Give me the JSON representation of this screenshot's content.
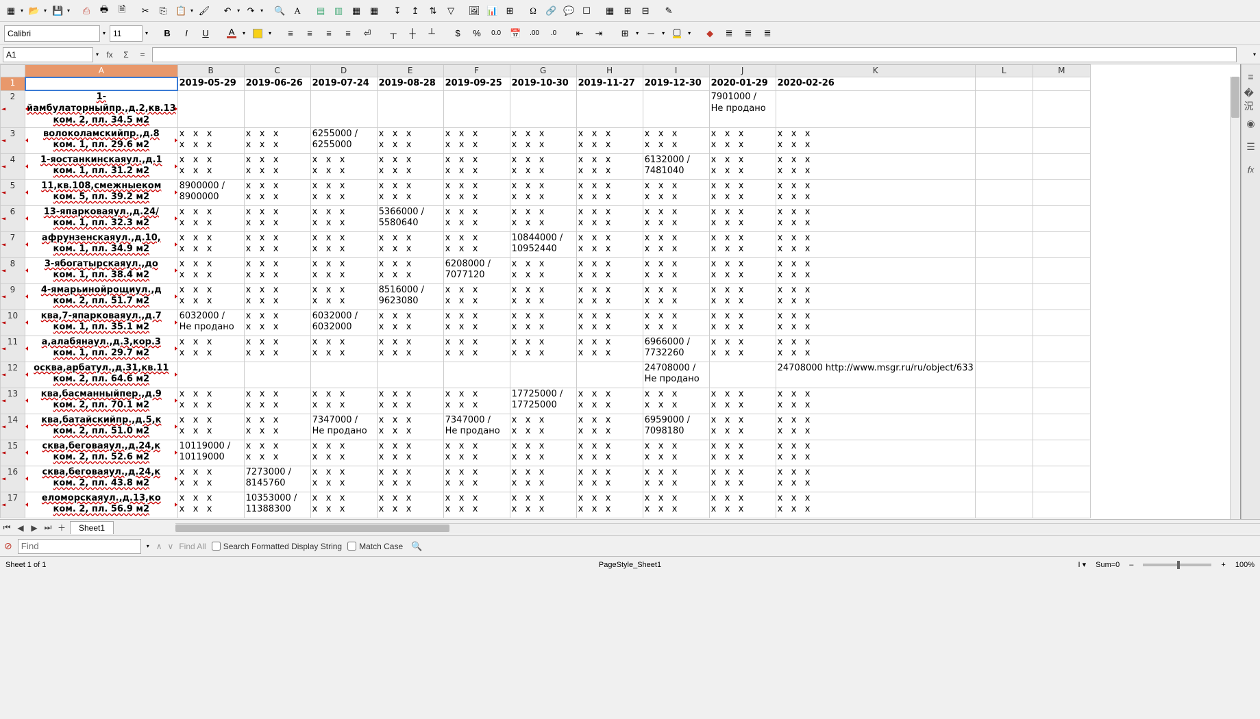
{
  "toolbar2": {
    "font_name": "Calibri",
    "font_size": "11"
  },
  "formula": {
    "cell_ref": "A1",
    "input": ""
  },
  "columns": [
    "A",
    "B",
    "C",
    "D",
    "E",
    "F",
    "G",
    "H",
    "I",
    "J",
    "K",
    "L",
    "M"
  ],
  "header_dates": [
    "2019-05-29",
    "2019-06-26",
    "2019-07-24",
    "2019-08-28",
    "2019-09-25",
    "2019-10-30",
    "2019-11-27",
    "2019-12-30",
    "2020-01-29",
    "2020-02-26"
  ],
  "rows": [
    {
      "n": 2,
      "a": "1-йамбулаторныйпр.,д.2,кв.13\nком. 2, пл. 34.5 м2",
      "b": "",
      "c": "",
      "d": "",
      "e": "",
      "f": "",
      "g": "",
      "h": "",
      "i": "",
      "j": "7901000 /\nНе продано",
      "k": ""
    },
    {
      "n": 3,
      "a": "волоколамскийпр.,д.8\nком. 1, пл. 29.6 м2",
      "b": "x   x   x\nx   x   x",
      "c": "x   x   x\nx   x   x",
      "d": "6255000 /\n6255000",
      "e": "x   x   x\nx   x   x",
      "f": "x   x   x\nx   x   x",
      "g": "x   x   x\nx   x   x",
      "h": "x   x   x\nx   x   x",
      "i": "x   x   x\nx   x   x",
      "j": "x   x   x\nx   x   x",
      "k": "x   x   x\nx   x   x"
    },
    {
      "n": 4,
      "a": "1-яостанкинскаяул.,д.1\nком. 1, пл. 31.2 м2",
      "b": "x   x   x\nx   x   x",
      "c": "x   x   x\nx   x   x",
      "d": "x   x   x\nx   x   x",
      "e": "x   x   x\nx   x   x",
      "f": "x   x   x\nx   x   x",
      "g": "x   x   x\nx   x   x",
      "h": "x   x   x\nx   x   x",
      "i": "6132000 /\n7481040",
      "j": "x   x   x\nx   x   x",
      "k": "x   x   x\nx   x   x"
    },
    {
      "n": 5,
      "a": "11,кв.108,смежныеком\nком. 5, пл. 39.2 м2",
      "b": "8900000 /\n8900000",
      "c": "x   x   x\nx   x   x",
      "d": "x   x   x\nx   x   x",
      "e": "x   x   x\nx   x   x",
      "f": "x   x   x\nx   x   x",
      "g": "x   x   x\nx   x   x",
      "h": "x   x   x\nx   x   x",
      "i": "x   x   x\nx   x   x",
      "j": "x   x   x\nx   x   x",
      "k": "x   x   x\nx   x   x"
    },
    {
      "n": 6,
      "a": "13-япарковаяул.,д.24/\nком. 1, пл. 32.3 м2",
      "b": "x   x   x\nx   x   x",
      "c": "x   x   x\nx   x   x",
      "d": "x   x   x\nx   x   x",
      "e": "5366000 /\n5580640",
      "f": "x   x   x\nx   x   x",
      "g": "x   x   x\nx   x   x",
      "h": "x   x   x\nx   x   x",
      "i": "x   x   x\nx   x   x",
      "j": "x   x   x\nx   x   x",
      "k": "x   x   x\nx   x   x"
    },
    {
      "n": 7,
      "a": "афрунзенскаяул.,д.10,\nком. 1, пл. 34.9 м2",
      "b": "x   x   x\nx   x   x",
      "c": "x   x   x\nx   x   x",
      "d": "x   x   x\nx   x   x",
      "e": "x   x   x\nx   x   x",
      "f": "x   x   x\nx   x   x",
      "g": "10844000 /\n10952440",
      "h": "x   x   x\nx   x   x",
      "i": "x   x   x\nx   x   x",
      "j": "x   x   x\nx   x   x",
      "k": "x   x   x\nx   x   x"
    },
    {
      "n": 8,
      "a": "3-ябогатырскаяул.,до\nком. 1, пл. 38.4 м2",
      "b": "x   x   x\nx   x   x",
      "c": "x   x   x\nx   x   x",
      "d": "x   x   x\nx   x   x",
      "e": "x   x   x\nx   x   x",
      "f": "6208000 /\n7077120",
      "g": "x   x   x\nx   x   x",
      "h": "x   x   x\nx   x   x",
      "i": "x   x   x\nx   x   x",
      "j": "x   x   x\nx   x   x",
      "k": "x   x   x\nx   x   x"
    },
    {
      "n": 9,
      "a": "4-ямарьинойрощиул.,д\nком. 2, пл. 51.7 м2",
      "b": "x   x   x\nx   x   x",
      "c": "x   x   x\nx   x   x",
      "d": "x   x   x\nx   x   x",
      "e": "8516000 /\n9623080",
      "f": "x   x   x\nx   x   x",
      "g": "x   x   x\nx   x   x",
      "h": "x   x   x\nx   x   x",
      "i": "x   x   x\nx   x   x",
      "j": "x   x   x\nx   x   x",
      "k": "x   x   x\nx   x   x"
    },
    {
      "n": 10,
      "a": "ква,7-япарковаяул.,д.7\nком. 1, пл. 35.1 м2",
      "b": "6032000 /\nНе продано",
      "c": "x   x   x\nx   x   x",
      "d": "6032000 /\n6032000",
      "e": "x   x   x\nx   x   x",
      "f": "x   x   x\nx   x   x",
      "g": "x   x   x\nx   x   x",
      "h": "x   x   x\nx   x   x",
      "i": "x   x   x\nx   x   x",
      "j": "x   x   x\nx   x   x",
      "k": "x   x   x\nx   x   x"
    },
    {
      "n": 11,
      "a": "а,алабянаул.,д.3,кор.3\nком. 1, пл. 29.7 м2",
      "b": "x   x   x\nx   x   x",
      "c": "x   x   x\nx   x   x",
      "d": "x   x   x\nx   x   x",
      "e": "x   x   x\nx   x   x",
      "f": "x   x   x\nx   x   x",
      "g": "x   x   x\nx   x   x",
      "h": "x   x   x\nx   x   x",
      "i": "6966000 /\n7732260",
      "j": "x   x   x\nx   x   x",
      "k": "x   x   x\nx   x   x"
    },
    {
      "n": 12,
      "a": "осква,арбатул.,д.31,кв.11\nком. 2, пл. 64.6 м2",
      "b": "",
      "c": "",
      "d": "",
      "e": "",
      "f": "",
      "g": "",
      "h": "",
      "i": "24708000 /\nНе продано",
      "j": "",
      "k": "24708000\nhttp://www.msgr.ru/ru/object/633"
    },
    {
      "n": 13,
      "a": "ква,басманныйпер.,д.9\nком. 2, пл. 70.1 м2",
      "b": "x   x   x\nx   x   x",
      "c": "x   x   x\nx   x   x",
      "d": "x   x   x\nx   x   x",
      "e": "x   x   x\nx   x   x",
      "f": "x   x   x\nx   x   x",
      "g": "17725000 /\n17725000",
      "h": "x   x   x\nx   x   x",
      "i": "x   x   x\nx   x   x",
      "j": "x   x   x\nx   x   x",
      "k": "x   x   x\nx   x   x"
    },
    {
      "n": 14,
      "a": "ква,батайскийпр.,д.5,к\nком. 2, пл. 51.0 м2",
      "b": "x   x   x\nx   x   x",
      "c": "x   x   x\nx   x   x",
      "d": "7347000 /\nНе продано",
      "e": "x   x   x\nx   x   x",
      "f": "7347000 /\nНе продано",
      "g": "x   x   x\nx   x   x",
      "h": "x   x   x\nx   x   x",
      "i": "6959000 /\n7098180",
      "j": "x   x   x\nx   x   x",
      "k": "x   x   x\nx   x   x"
    },
    {
      "n": 15,
      "a": "сква,беговаяул.,д.24,к\nком. 2, пл. 52.6 м2",
      "b": "10119000 /\n10119000",
      "c": "x   x   x\nx   x   x",
      "d": "x   x   x\nx   x   x",
      "e": "x   x   x\nx   x   x",
      "f": "x   x   x\nx   x   x",
      "g": "x   x   x\nx   x   x",
      "h": "x   x   x\nx   x   x",
      "i": "x   x   x\nx   x   x",
      "j": "x   x   x\nx   x   x",
      "k": "x   x   x\nx   x   x"
    },
    {
      "n": 16,
      "a": "сква,беговаяул.,д.24,к\nком. 2, пл. 43.8 м2",
      "b": "x   x   x\nx   x   x",
      "c": "7273000 /\n8145760",
      "d": "x   x   x\nx   x   x",
      "e": "x   x   x\nx   x   x",
      "f": "x   x   x\nx   x   x",
      "g": "x   x   x\nx   x   x",
      "h": "x   x   x\nx   x   x",
      "i": "x   x   x\nx   x   x",
      "j": "x   x   x\nx   x   x",
      "k": "x   x   x\nx   x   x"
    },
    {
      "n": 17,
      "a": "еломорскаяул.,д.13,ко\nком. 2, пл. 56.9 м2",
      "b": "x   x   x\nx   x   x",
      "c": "10353000 /\n11388300",
      "d": "x   x   x\nx   x   x",
      "e": "x   x   x\nx   x   x",
      "f": "x   x   x\nx   x   x",
      "g": "x   x   x\nx   x   x",
      "h": "x   x   x\nx   x   x",
      "i": "x   x   x\nx   x   x",
      "j": "x   x   x\nx   x   x",
      "k": "x   x   x\nx   x   x"
    }
  ],
  "tabs": {
    "sheet1": "Sheet1"
  },
  "find": {
    "placeholder": "Find",
    "find_all": "Find All",
    "opt_formatted": "Search Formatted Display String",
    "opt_matchcase": "Match Case"
  },
  "status": {
    "left": "Sheet 1 of 1",
    "center": "PageStyle_Sheet1",
    "insert": "I",
    "sum": "Sum=0",
    "zoom": "100%"
  }
}
